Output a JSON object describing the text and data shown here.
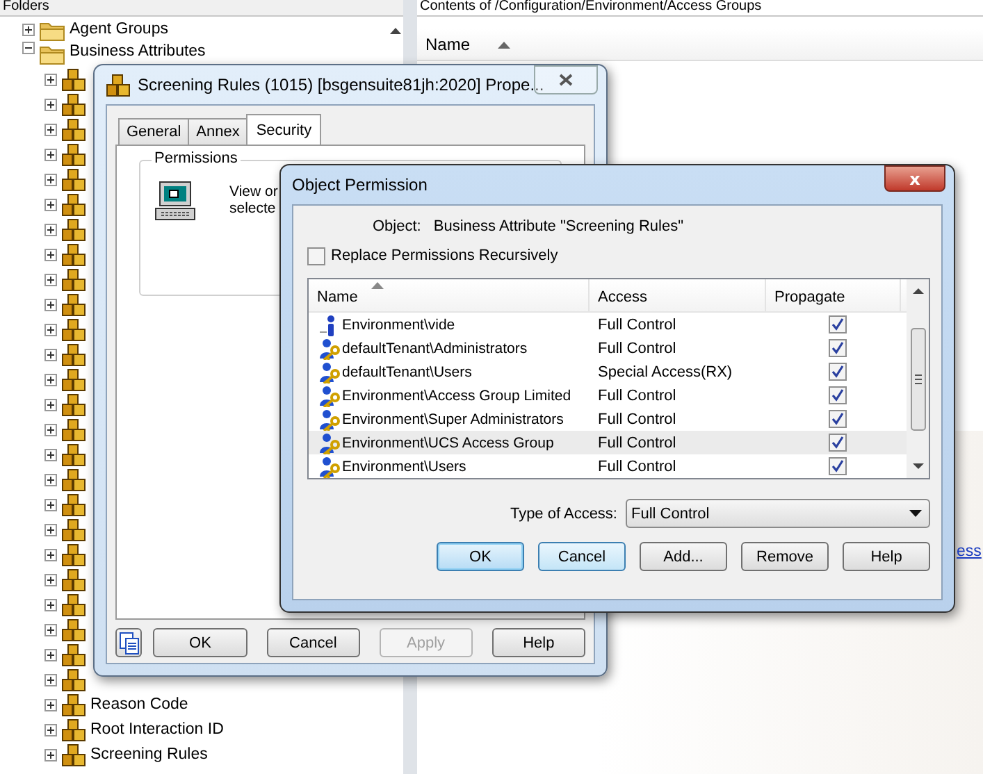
{
  "folders_panel": {
    "title": "Folders",
    "tree": [
      {
        "label": "Agent Groups",
        "expanded": false
      },
      {
        "label": "Business Attributes",
        "expanded": true,
        "children": [
          {
            "expanded": false
          },
          {
            "expanded": false
          },
          {
            "expanded": false
          },
          {
            "expanded": false
          },
          {
            "expanded": false
          },
          {
            "expanded": false
          },
          {
            "expanded": false
          },
          {
            "expanded": false
          },
          {
            "expanded": false
          },
          {
            "expanded": false
          },
          {
            "expanded": false
          },
          {
            "expanded": false
          },
          {
            "expanded": false
          },
          {
            "expanded": false
          },
          {
            "expanded": false
          },
          {
            "expanded": false
          },
          {
            "expanded": false
          },
          {
            "expanded": false
          },
          {
            "expanded": false
          },
          {
            "expanded": false
          },
          {
            "expanded": false
          },
          {
            "expanded": false
          },
          {
            "expanded": false
          },
          {
            "expanded": false
          },
          {
            "expanded": false
          },
          {
            "label": "Reason Code",
            "expanded": false
          },
          {
            "label": "Root Interaction ID",
            "expanded": false
          },
          {
            "label": "Screening Rules",
            "expanded": false
          }
        ]
      }
    ]
  },
  "contents_panel": {
    "title": "Contents of /Configuration/Environment/Access Groups",
    "columns": [
      "Name"
    ],
    "link_fragment": "ess"
  },
  "properties_dialog": {
    "title": "Screening Rules (1015) [bsgensuite81jh:2020] Prope...",
    "tabs": [
      {
        "label": "General",
        "selected": false
      },
      {
        "label": "Annex",
        "selected": false
      },
      {
        "label": "Security",
        "selected": true
      }
    ],
    "group_label": "Permissions",
    "description_lines": [
      "View or",
      "selecte"
    ],
    "buttons": [
      {
        "label": "OK",
        "disabled": false
      },
      {
        "label": "Cancel",
        "disabled": false
      },
      {
        "label": "Apply",
        "disabled": true
      },
      {
        "label": "Help",
        "disabled": false
      }
    ]
  },
  "permission_dialog": {
    "title": "Object Permission",
    "close": "x",
    "object_label": "Object:",
    "object_value": "Business Attribute \"Screening Rules\"",
    "recursive": {
      "label": "Replace Permissions Recursively",
      "checked": false
    },
    "columns": [
      "Name",
      "Access",
      "Propagate"
    ],
    "rows": [
      {
        "kind": "user",
        "name": "Environment\\vide",
        "access": "Full Control",
        "propagate": true,
        "selected": false
      },
      {
        "kind": "group",
        "name": "defaultTenant\\Administrators",
        "access": "Full Control",
        "propagate": true,
        "selected": false
      },
      {
        "kind": "group",
        "name": "defaultTenant\\Users",
        "access": "Special Access(RX)",
        "propagate": true,
        "selected": false
      },
      {
        "kind": "group",
        "name": "Environment\\Access Group Limited",
        "access": "Full Control",
        "propagate": true,
        "selected": false
      },
      {
        "kind": "group",
        "name": "Environment\\Super Administrators",
        "access": "Full Control",
        "propagate": true,
        "selected": false
      },
      {
        "kind": "group",
        "name": "Environment\\UCS Access Group",
        "access": "Full Control",
        "propagate": true,
        "selected": true
      },
      {
        "kind": "group",
        "name": "Environment\\Users",
        "access": "Full Control",
        "propagate": true,
        "selected": false
      }
    ],
    "type_label": "Type of Access:",
    "type_value": "Full Control",
    "buttons": [
      {
        "label": "OK",
        "kind": "default"
      },
      {
        "label": "Cancel",
        "kind": "focus"
      },
      {
        "label": "Add...",
        "kind": "normal"
      },
      {
        "label": "Remove",
        "kind": "normal"
      },
      {
        "label": "Help",
        "kind": "normal"
      }
    ]
  }
}
